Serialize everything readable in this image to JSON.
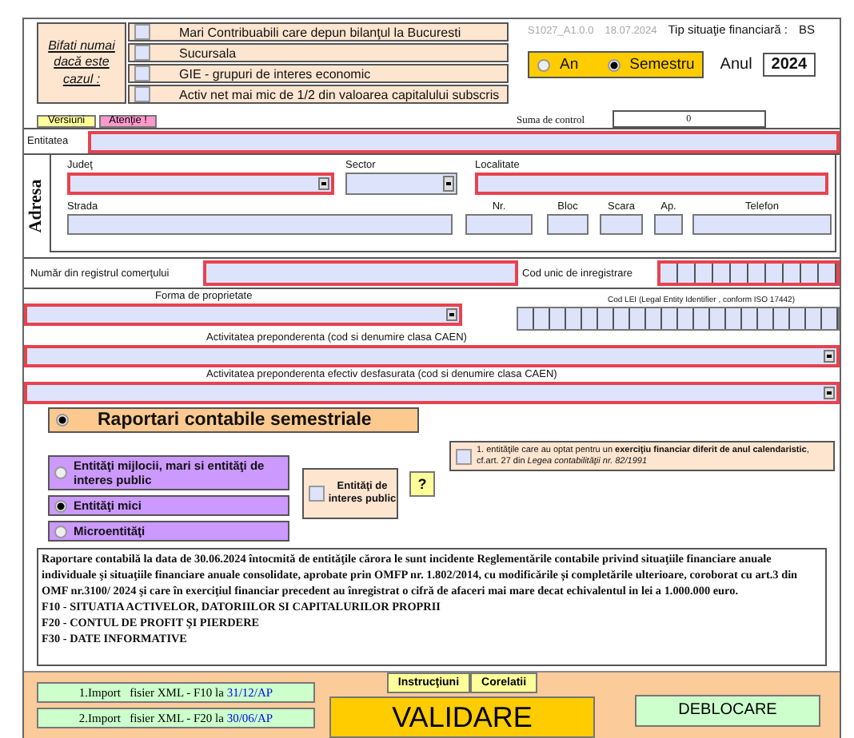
{
  "header": {
    "hint": "Bifati numai dacă este cazul :",
    "options": [
      {
        "label": "Mari Contribuabili care depun bilanţul la Bucuresti",
        "checked": false
      },
      {
        "label": "Sucursala",
        "checked": false
      },
      {
        "label": "GIE - grupuri de interes economic",
        "checked": false
      },
      {
        "label": "Activ net mai mic de 1/2 din valoarea capitalului subscris",
        "checked": false
      }
    ],
    "version": "S1027_A1.0.0",
    "date": "18.07.2024",
    "type_label": "Tip situaţie financiară :",
    "type_value": "BS",
    "period": [
      {
        "label": "An",
        "selected": false
      },
      {
        "label": "Semestru",
        "selected": true
      }
    ],
    "year_label": "Anul",
    "year": "2024"
  },
  "tabs": [
    {
      "label": "Versiuni",
      "color": "#ffff99"
    },
    {
      "label": "Atenţie !",
      "color": "#ff99cc"
    }
  ],
  "control_sum": {
    "label": "Suma de control",
    "value": "0"
  },
  "entity": {
    "label": "Entitatea",
    "required": true
  },
  "address": {
    "title": "Adresa",
    "fields": [
      {
        "label": "Judeţ",
        "kind": "dropdown",
        "required": true
      },
      {
        "label": "Sector",
        "kind": "dropdown",
        "required": false
      },
      {
        "label": "Localitate",
        "kind": "text",
        "required": true
      },
      {
        "label": "Strada",
        "kind": "text",
        "required": false
      },
      {
        "label": "Nr.",
        "kind": "text",
        "required": false
      },
      {
        "label": "Bloc",
        "kind": "text",
        "required": false
      },
      {
        "label": "Scara",
        "kind": "text",
        "required": false
      },
      {
        "label": "Ap.",
        "kind": "text",
        "required": false
      },
      {
        "label": "Telefon",
        "kind": "text",
        "required": false
      }
    ]
  },
  "registry": {
    "label": "Număr din registrul comerţului",
    "required": true
  },
  "cui": {
    "label": "Cod unic de inregistrare",
    "kind": "cui-boxes",
    "required": true
  },
  "ownership": {
    "label": "Forma de proprietate",
    "kind": "dropdown",
    "required": true
  },
  "lei": {
    "label": "Cod LEI  (Legal Entity Identifier , conform ISO 17442)",
    "kind": "lei-boxes",
    "required": false
  },
  "activities": [
    {
      "label": "Activitatea preponderenta (cod si denumire clasa CAEN)",
      "kind": "dropdown",
      "required": true
    },
    {
      "label": "Activitatea preponderenta efectiv desfasurata (cod si denumire clasa CAEN)",
      "kind": "dropdown",
      "required": true
    }
  ],
  "reporting": {
    "label": "Raportari contabile semestriale",
    "selected": true
  },
  "categories": [
    {
      "label": "Entităţi mijlocii, mari si entităţi de interes public",
      "selected": false
    },
    {
      "label": "Entităţi mici",
      "selected": true
    },
    {
      "label": "Microentităţi",
      "selected": false
    }
  ],
  "public_interest": {
    "label": "Entităţi de interes public",
    "checked": false
  },
  "help_button": "?",
  "fiscal_year_note": {
    "text": "1. entităţile care au optat pentru un **exerciţiu financiar diferit de anul calendaristic**, cf.art. 27 din *Legea contabilităţii nr. 82/1991*",
    "checked": false
  },
  "description": {
    "paragraph": "Raportare contabilă la data de 30.06.2024 întocmită de entităţile cărora le sunt incidente Reglementările contabile privind situaţiile financiare anuale individuale şi situaţiile financiare anuale consolidate, aprobate prin OMFP nr. 1.802/2014, cu modificările și completările ulterioare, coroborat cu art.3 din OMF nr.3100/ 2024 şi care în exerciţiul financiar precedent au înregistrat o cifră de afaceri mai mare decat echivalentul in lei a 1.000.000 euro.",
    "lines": [
      "F10 - SITUATIA ACTIVELOR, DATORIILOR SI CAPITALURILOR PROPRII",
      "F20 - CONTUL DE PROFIT ŞI PIERDERE",
      "F30 - DATE INFORMATIVE"
    ]
  },
  "bottom": {
    "tabs": [
      "Instrucţiuni",
      "Corelatii"
    ],
    "imports": [
      {
        "text": "1.Import   fisier XML - F10 la",
        "link": "31/12/AP"
      },
      {
        "text": "2.Import   fisier XML - F20 la",
        "link": "30/06/AP"
      }
    ],
    "validate": "VALIDARE",
    "unlock": "DEBLOCARE"
  }
}
